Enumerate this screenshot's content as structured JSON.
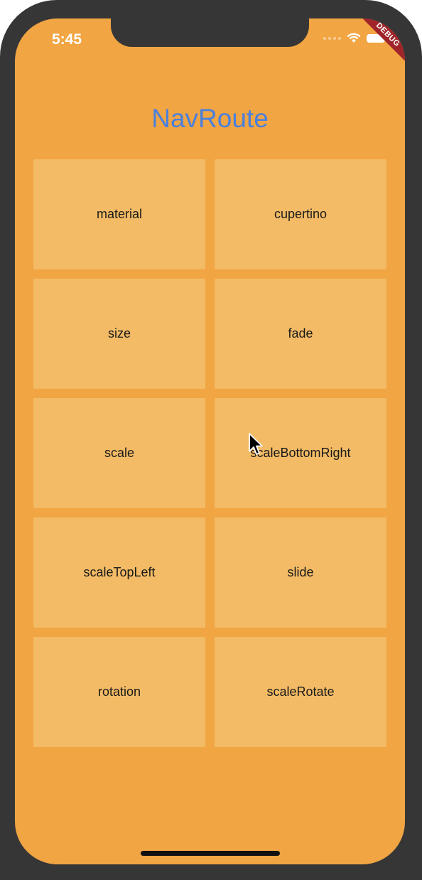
{
  "status_bar": {
    "time": "5:45",
    "debug_banner": "DEBUG"
  },
  "app": {
    "title": "NavRoute"
  },
  "routes": [
    {
      "label": "material"
    },
    {
      "label": "cupertino"
    },
    {
      "label": "size"
    },
    {
      "label": "fade"
    },
    {
      "label": "scale"
    },
    {
      "label": "scaleBottomRight"
    },
    {
      "label": "scaleTopLeft"
    },
    {
      "label": "slide"
    },
    {
      "label": "rotation"
    },
    {
      "label": "scaleRotate"
    }
  ],
  "colors": {
    "background": "#f1a543",
    "tile": "#f3bb65",
    "title": "#4a80dc",
    "bezel": "#363636",
    "debug_ribbon": "#a0252b"
  }
}
